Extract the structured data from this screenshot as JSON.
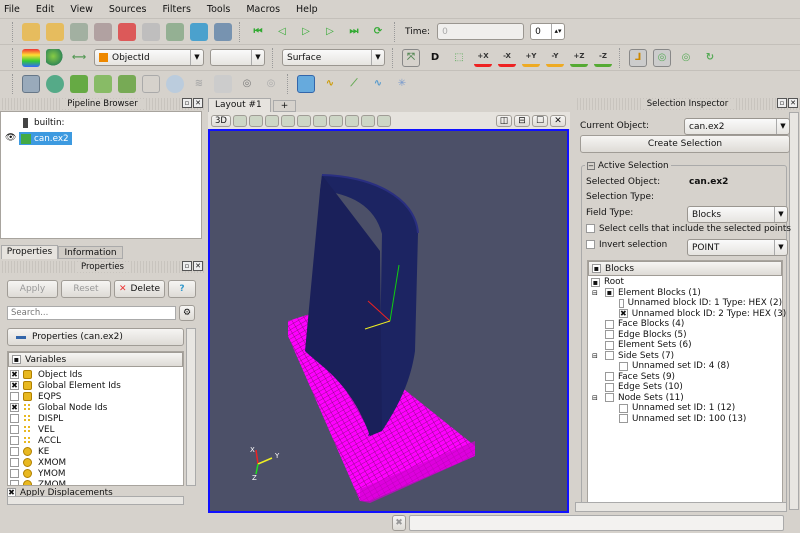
{
  "menu": [
    "File",
    "Edit",
    "View",
    "Sources",
    "Filters",
    "Tools",
    "Macros",
    "Help"
  ],
  "toolbar1": {
    "icons": [
      "open-file-icon",
      "open-recent-icon",
      "connect-icon",
      "disconnect-icon",
      "undo-icon",
      "redo-icon",
      "find-data-icon",
      "help-icon",
      "save-screenshot-icon"
    ],
    "vcr_icons": [
      "first-frame-icon",
      "previous-frame-icon",
      "play-icon",
      "next-frame-icon",
      "last-frame-icon",
      "loop-icon"
    ],
    "time_label": "Time:",
    "time_value": "0",
    "time_index": "0"
  },
  "toolbar2": {
    "color_by": "ObjectId",
    "component": "",
    "representation": "Surface",
    "camera_buttons": [
      "+X",
      "-X",
      "+Y",
      "-Y",
      "+Z",
      "-Z"
    ]
  },
  "pipeline": {
    "title": "Pipeline Browser",
    "items": [
      "builtin:",
      "can.ex2"
    ]
  },
  "tabs": {
    "properties": "Properties",
    "information": "Information"
  },
  "properties": {
    "title": "Properties",
    "apply": "Apply",
    "reset": "Reset",
    "delete": "Delete",
    "help": "?",
    "search_placeholder": "Search...",
    "section": "Properties (can.ex2)",
    "variables_header": "Variables",
    "variables": [
      {
        "name": "Object Ids",
        "checked": true,
        "kind": "cell"
      },
      {
        "name": "Global Element Ids",
        "checked": true,
        "kind": "cell"
      },
      {
        "name": "EQPS",
        "checked": false,
        "kind": "cell"
      },
      {
        "name": "Global Node Ids",
        "checked": true,
        "kind": "point"
      },
      {
        "name": "DISPL",
        "checked": false,
        "kind": "point"
      },
      {
        "name": "VEL",
        "checked": false,
        "kind": "point"
      },
      {
        "name": "ACCL",
        "checked": false,
        "kind": "point"
      },
      {
        "name": "KE",
        "checked": false,
        "kind": "global"
      },
      {
        "name": "XMOM",
        "checked": false,
        "kind": "global"
      },
      {
        "name": "YMOM",
        "checked": false,
        "kind": "global"
      },
      {
        "name": "ZMOM",
        "checked": false,
        "kind": "global"
      }
    ],
    "apply_displacements": "Apply Displacements"
  },
  "layout": {
    "tab": "Layout #1",
    "add": "+",
    "view_mode": "3D",
    "axes": {
      "x": "X",
      "y": "Y",
      "z": "Z"
    }
  },
  "selection": {
    "title": "Selection Inspector",
    "current_object_label": "Current Object:",
    "current_object": "can.ex2",
    "create": "Create Selection",
    "active": "Active Selection",
    "selected_object_label": "Selected Object:",
    "selected_object": "can.ex2",
    "selection_type_label": "Selection Type:",
    "selection_type": "Blocks",
    "field_type_label": "Field Type:",
    "field_type": "POINT",
    "select_cells": "Select cells that include the selected points",
    "invert": "Invert selection",
    "blocks_header": "Blocks",
    "tree": [
      {
        "label": "Root",
        "level": 0,
        "checked": "partial",
        "expander": false
      },
      {
        "label": "Element Blocks (1)",
        "level": 1,
        "checked": "partial",
        "expander": true
      },
      {
        "label": "Unnamed block ID: 1 Type: HEX (2)",
        "level": 2,
        "checked": "no"
      },
      {
        "label": "Unnamed block ID: 2 Type: HEX (3)",
        "level": 2,
        "checked": "yes"
      },
      {
        "label": "Face Blocks (4)",
        "level": 1,
        "checked": "no"
      },
      {
        "label": "Edge Blocks (5)",
        "level": 1,
        "checked": "no"
      },
      {
        "label": "Element Sets (6)",
        "level": 1,
        "checked": "no"
      },
      {
        "label": "Side Sets (7)",
        "level": 1,
        "checked": "no",
        "expander": true
      },
      {
        "label": "Unnamed set ID: 4 (8)",
        "level": 2,
        "checked": "no"
      },
      {
        "label": "Face Sets (9)",
        "level": 1,
        "checked": "no"
      },
      {
        "label": "Edge Sets (10)",
        "level": 1,
        "checked": "no"
      },
      {
        "label": "Node Sets (11)",
        "level": 1,
        "checked": "no",
        "expander": true
      },
      {
        "label": "Unnamed set ID: 1 (12)",
        "level": 2,
        "checked": "no"
      },
      {
        "label": "Unnamed set ID: 100 (13)",
        "level": 2,
        "checked": "no"
      }
    ]
  },
  "colors": {
    "viewport_bg": "#4c5068",
    "cylinder": "#1c2462",
    "slab": "#ff00ff",
    "selection_highlight": "#3d9ae0"
  }
}
